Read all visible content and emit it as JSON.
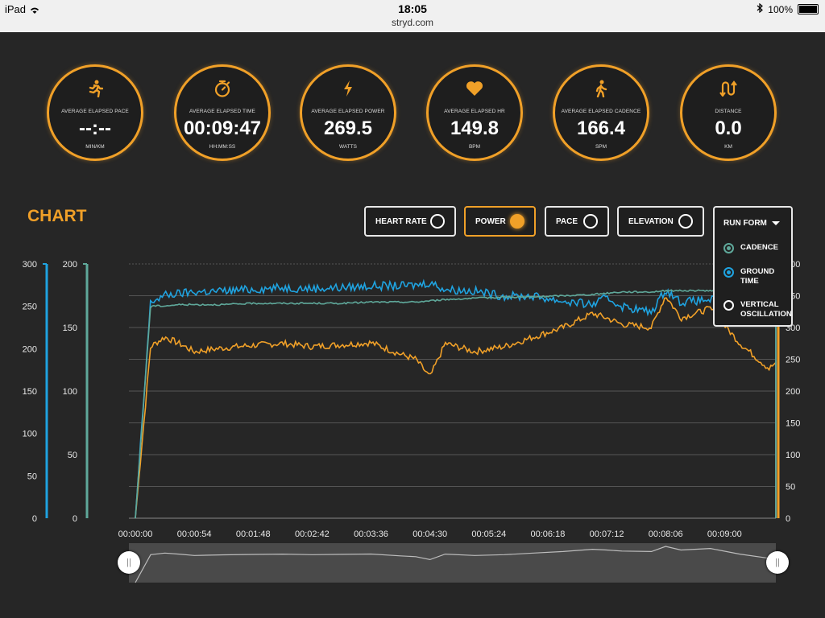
{
  "status_bar": {
    "device": "iPad",
    "time": "18:05",
    "url": "stryd.com",
    "battery": "100%"
  },
  "stats": [
    {
      "label": "AVERAGE ELAPSED PACE",
      "value": "--:--",
      "unit": "MIN/KM",
      "icon": "running-icon"
    },
    {
      "label": "AVERAGE ELAPSED TIME",
      "value": "00:09:47",
      "unit": "HH:MM:SS",
      "icon": "stopwatch-icon"
    },
    {
      "label": "AVERAGE ELAPSED POWER",
      "value": "269.5",
      "unit": "WATTS",
      "icon": "lightning-icon"
    },
    {
      "label": "AVERAGE ELAPSED HR",
      "value": "149.8",
      "unit": "BPM",
      "icon": "heart-icon"
    },
    {
      "label": "AVERAGE ELAPSED CADENCE",
      "value": "166.4",
      "unit": "SPM",
      "icon": "walking-icon"
    },
    {
      "label": "DISTANCE",
      "value": "0.0",
      "unit": "KM",
      "icon": "route-icon"
    }
  ],
  "chart_title": "CHART",
  "toggles": [
    {
      "label": "HEART RATE",
      "on": false
    },
    {
      "label": "POWER",
      "on": true
    },
    {
      "label": "PACE",
      "on": false
    },
    {
      "label": "ELEVATION",
      "on": false
    }
  ],
  "run_form": {
    "label": "RUN FORM",
    "items": [
      {
        "label": "CADENCE",
        "state": "teal"
      },
      {
        "label": "GROUND TIME",
        "state": "blue"
      },
      {
        "label": "VERTICAL OSCILLATION",
        "state": "off"
      }
    ]
  },
  "colors": {
    "accent": "#f0a028",
    "ground_time": "#1fa3e0",
    "cadence": "#5fa89a",
    "background": "#262626"
  },
  "chart_data": {
    "type": "line",
    "x": [
      "00:00:00",
      "00:00:14",
      "00:00:27",
      "00:00:40",
      "00:00:54",
      "00:01:21",
      "00:01:48",
      "00:02:15",
      "00:02:42",
      "00:03:09",
      "00:03:36",
      "00:04:03",
      "00:04:17",
      "00:04:30",
      "00:04:44",
      "00:05:11",
      "00:05:38",
      "00:06:05",
      "00:06:32",
      "00:06:59",
      "00:07:12",
      "00:07:26",
      "00:07:53",
      "00:08:06",
      "00:08:20",
      "00:08:47",
      "00:09:14",
      "00:09:41",
      "00:09:47"
    ],
    "xticks": [
      "00:00:00",
      "00:00:54",
      "00:01:48",
      "00:02:42",
      "00:03:36",
      "00:04:30",
      "00:05:24",
      "00:06:18",
      "00:07:12",
      "00:08:06",
      "00:09:00"
    ],
    "left_axis_1": {
      "ticks": [
        "0",
        "50",
        "100",
        "150",
        "200",
        "250",
        "300"
      ],
      "ylim": [
        0,
        300
      ]
    },
    "left_axis_2": {
      "ticks": [
        "0",
        "50",
        "100",
        "150",
        "200"
      ],
      "ylim": [
        0,
        200
      ]
    },
    "right_axis": {
      "ticks": [
        "0",
        "50",
        "100",
        "150",
        "200",
        "250",
        "300",
        "350",
        "400"
      ],
      "ylim": [
        0,
        400
      ]
    },
    "series": [
      {
        "name": "POWER",
        "axis": "right",
        "values": [
          0,
          270,
          285,
          275,
          262,
          268,
          272,
          275,
          270,
          273,
          276,
          258,
          250,
          222,
          275,
          262,
          270,
          285,
          300,
          322,
          315,
          305,
          300,
          350,
          315,
          330,
          275,
          235,
          245
        ]
      },
      {
        "name": "GROUND TIME",
        "axis": "left_1",
        "values": [
          0,
          255,
          263,
          265,
          267,
          268,
          270,
          272,
          271,
          272,
          274,
          274,
          275,
          278,
          270,
          268,
          262,
          262,
          256,
          252,
          260,
          250,
          243,
          270,
          255,
          258,
          262,
          260,
          262
        ]
      },
      {
        "name": "CADENCE",
        "axis": "left_2",
        "values": [
          0,
          167,
          167,
          168,
          168,
          168,
          169,
          169,
          169,
          169,
          170,
          170,
          170,
          171,
          172,
          173,
          174,
          174,
          175,
          176,
          177,
          178,
          178,
          179,
          179,
          179,
          178,
          177,
          177
        ]
      }
    ]
  }
}
